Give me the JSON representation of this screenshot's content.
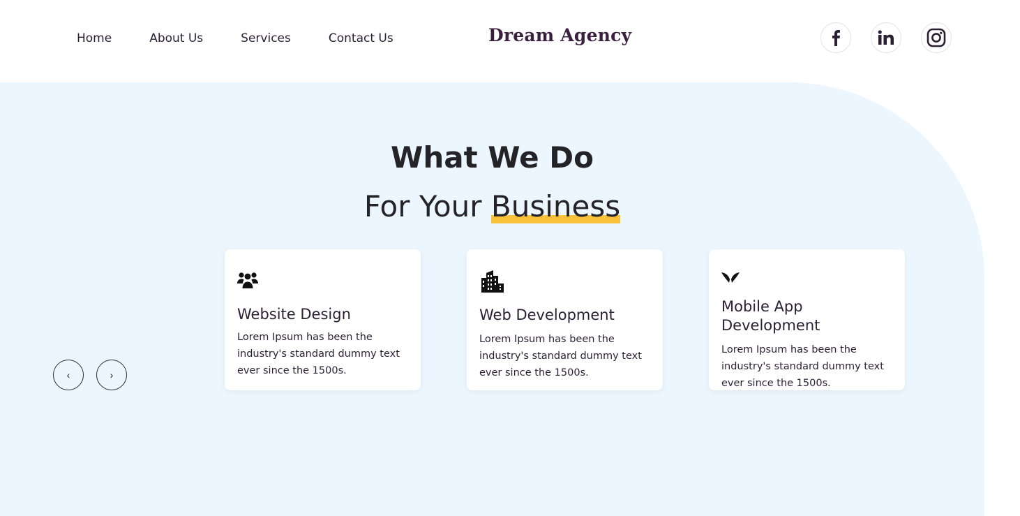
{
  "nav": {
    "items": [
      "Home",
      "About Us",
      "Services",
      "Contact Us"
    ]
  },
  "brand": {
    "name": "Dream Agency"
  },
  "social": {
    "icons": [
      "facebook-icon",
      "linkedin-icon",
      "instagram-icon"
    ]
  },
  "hero": {
    "title": "What We Do",
    "subtitle_prefix": "For Your ",
    "subtitle_highlight": "Business"
  },
  "carousel": {
    "prev_label": "‹",
    "next_label": "›"
  },
  "cards": [
    {
      "icon": "users-icon",
      "title": "Website Design",
      "text": "Lorem Ipsum has been the industry's standard dummy text ever since the 1500s."
    },
    {
      "icon": "building-icon",
      "title": "Web Development",
      "text": "Lorem Ipsum has been the industry's standard dummy text ever since the 1500s."
    },
    {
      "icon": "wings-icon",
      "title": "Mobile App Development",
      "text": "Lorem Ipsum has been the industry's standard dummy text ever since the 1500s."
    }
  ],
  "colors": {
    "panel": "#ecf6ff",
    "accent": "#f7c13a",
    "brand": "#3a1f3f"
  }
}
